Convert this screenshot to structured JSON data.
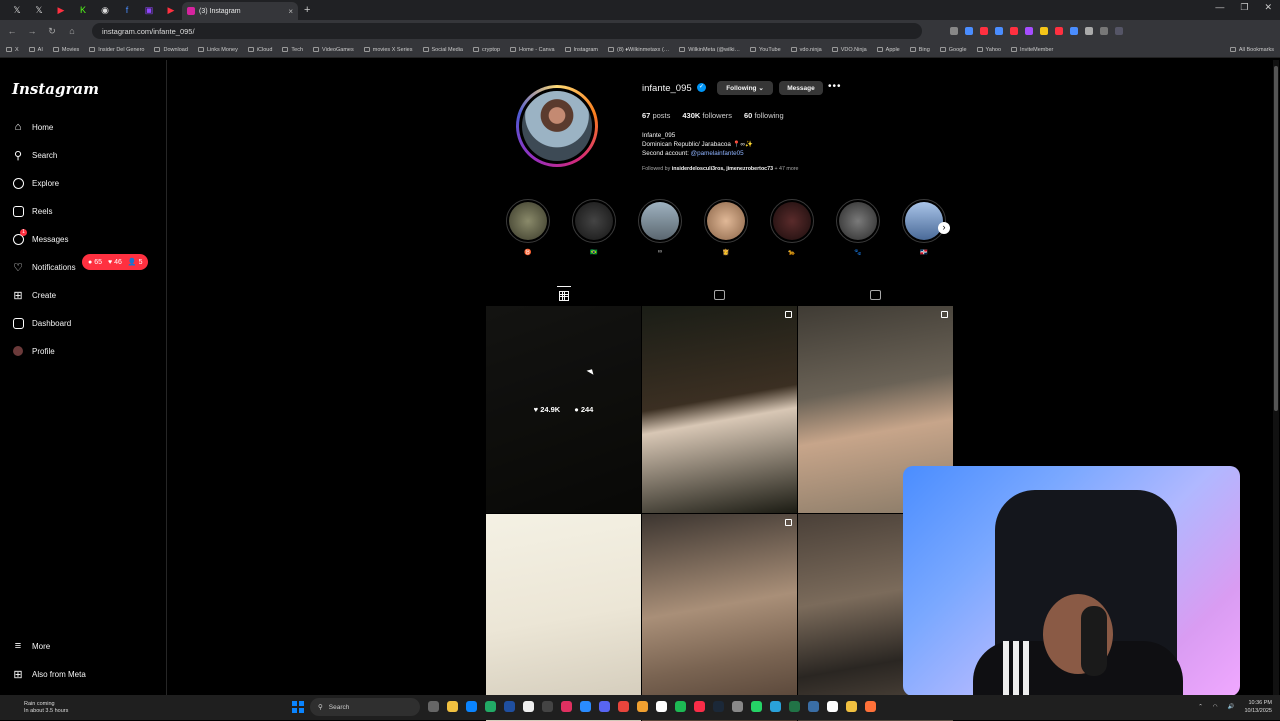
{
  "browser": {
    "tab_title": "(3) Instagram",
    "url": "instagram.com/infante_095/",
    "bookmarks": [
      "X",
      "AI",
      "Movies",
      "Insider Del Genero",
      "Download",
      "Links Money",
      "iCloud",
      "Tech",
      "VideoGames",
      "movies X Series",
      "Social Media",
      "cryptop",
      "Home - Canva",
      "Instagram",
      "(8) ♦Wilkinmetaxx (…",
      "WilkinMeta (@wilki…",
      "YouTube",
      "vdo.ninja",
      "VDO.Ninja",
      "Apple",
      "Bing",
      "Google",
      "Yahoo",
      "InviteMember"
    ],
    "all_bookmarks": "All Bookmarks"
  },
  "sidebar": {
    "logo": "Instagram",
    "items": [
      {
        "label": "Home",
        "icon": "home-icon"
      },
      {
        "label": "Search",
        "icon": "search-icon"
      },
      {
        "label": "Explore",
        "icon": "compass-icon"
      },
      {
        "label": "Reels",
        "icon": "reels-icon"
      },
      {
        "label": "Messages",
        "icon": "messenger-icon"
      },
      {
        "label": "Notifications",
        "icon": "heart-icon"
      },
      {
        "label": "Create",
        "icon": "plus-square-icon"
      },
      {
        "label": "Dashboard",
        "icon": "dashboard-icon"
      },
      {
        "label": "Profile",
        "icon": "avatar"
      }
    ],
    "messages_badge": "1",
    "notif_badge": {
      "comments": "65",
      "likes": "46",
      "follows": "5"
    },
    "more": "More",
    "also_from_meta": "Also from Meta"
  },
  "profile": {
    "username": "infante_095",
    "following_btn": "Following",
    "message_btn": "Message",
    "posts_count": "67",
    "posts_label": "posts",
    "followers_count": "430K",
    "followers_label": "followers",
    "following_count": "60",
    "following_label": "following",
    "bio_name": "Infante_095",
    "bio_line1": "Dominican Republic/ Jarabacoa 📍∞✨",
    "bio_line2_prefix": "Second account: ",
    "bio_line2_link": "@pamelainfante05",
    "followed_prefix": "Followed by ",
    "followed_names": "insiderdelosculi3ros, jimenezrobertoc73",
    "followed_suffix": " + 47 more"
  },
  "highlights": [
    {
      "label": "♉",
      "color": "#6a6a5a"
    },
    {
      "label": "🇧🇷",
      "color": "#2a2a2a"
    },
    {
      "label": "∞",
      "color": "#7a8a94"
    },
    {
      "label": "👸",
      "color": "#c7a47c"
    },
    {
      "label": "🐆",
      "color": "#3a1d1d"
    },
    {
      "label": "🐾",
      "color": "#4a4a4a"
    },
    {
      "label": "🇩🇴",
      "color": "#6c8cb8"
    }
  ],
  "tabs": [
    "posts-grid",
    "reels",
    "tagged"
  ],
  "posts": [
    {
      "likes": "24.9K",
      "comments": "244",
      "bg": "linear-gradient(160deg,#2b2b27,#14140f)"
    },
    {
      "bg": "linear-gradient(170deg,#1a1d16,#3b2f22 45%,#d8c7b5 55%,#1b1b13)"
    },
    {
      "bg": "linear-gradient(170deg,#3f3b34,#6a6256 40%,#c7a58a 60%,#8a7b68)"
    },
    {
      "bg": "linear-gradient(170deg,#f4f1e4,#ece6d6 50%,#cfc7b6)"
    },
    {
      "bg": "linear-gradient(170deg,#3c3530,#a98f78 45%,#7a6452 70%,#4b3a2f)"
    },
    {
      "bg": "linear-gradient(170deg,#4a4038,#7b6b5b 40%,#2a2622 70%,#5c5044)"
    }
  ],
  "taskbar": {
    "weather_title": "Rain coming",
    "weather_sub": "In about 3.5 hours",
    "search": "Search",
    "time": "10:36 PM",
    "date": "10/13/2025"
  }
}
